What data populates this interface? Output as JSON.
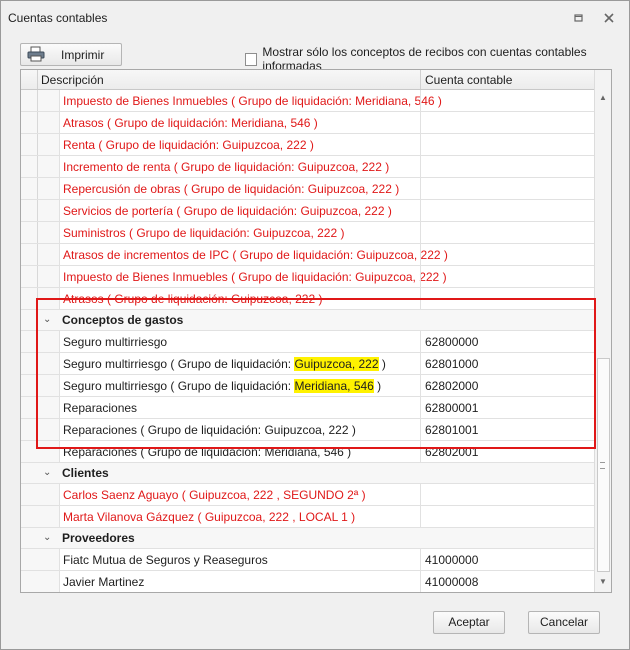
{
  "window": {
    "title": "Cuentas contables"
  },
  "toolbar": {
    "print_label": "Imprimir",
    "checkbox_label": "Mostrar sólo los conceptos de recibos con cuentas contables informadas",
    "checkbox_checked": false
  },
  "grid": {
    "columns": [
      "Descripción",
      "Cuenta contable"
    ],
    "rows_top": [
      {
        "desc": "Impuesto de Bienes Inmuebles ( Grupo de liquidación: Meridiana, 546 )",
        "acct": ""
      },
      {
        "desc": "Atrasos ( Grupo de liquidación: Meridiana, 546 )",
        "acct": ""
      },
      {
        "desc": "Renta ( Grupo de liquidación: Guipuzcoa, 222 )",
        "acct": ""
      },
      {
        "desc": "Incremento de renta ( Grupo de liquidación: Guipuzcoa, 222 )",
        "acct": ""
      },
      {
        "desc": "Repercusión de obras ( Grupo de liquidación: Guipuzcoa, 222 )",
        "acct": ""
      },
      {
        "desc": "Servicios de portería ( Grupo de liquidación: Guipuzcoa, 222 )",
        "acct": ""
      },
      {
        "desc": "Suministros ( Grupo de liquidación: Guipuzcoa, 222 )",
        "acct": ""
      },
      {
        "desc": "Atrasos de incrementos de IPC ( Grupo de liquidación: Guipuzcoa, 222 )",
        "acct": ""
      },
      {
        "desc": "Impuesto de Bienes Inmuebles ( Grupo de liquidación: Guipuzcoa, 222 )",
        "acct": ""
      },
      {
        "desc": "Atrasos ( Grupo de liquidación: Guipuzcoa, 222 )",
        "acct": ""
      }
    ],
    "group_gastos": {
      "label": "Conceptos de gastos",
      "r1": {
        "desc": "Seguro multirriesgo",
        "acct": "62800000"
      },
      "r2": {
        "pre": "Seguro multirriesgo ( Grupo de liquidación: ",
        "hl": "Guipuzcoa, 222",
        "post": " )",
        "acct": "62801000"
      },
      "r3": {
        "pre": "Seguro multirriesgo ( Grupo de liquidación: ",
        "hl": "Meridiana, 546",
        "post": " )",
        "acct": "62802000"
      },
      "r4": {
        "desc": "Reparaciones",
        "acct": "62800001"
      },
      "r5": {
        "desc": "Reparaciones ( Grupo de liquidación: Guipuzcoa, 222 )",
        "acct": "62801001"
      },
      "r6": {
        "desc": "Reparaciones ( Grupo de liquidación: Meridiana, 546 )",
        "acct": "62802001"
      }
    },
    "group_clientes": {
      "label": "Clientes",
      "r1": {
        "desc": "Carlos Saenz Aguayo ( Guipuzcoa, 222 , SEGUNDO 2ª )",
        "acct": ""
      },
      "r2": {
        "desc": "Marta Vilanova Gázquez ( Guipuzcoa, 222 , LOCAL 1 )",
        "acct": ""
      }
    },
    "group_proveedores": {
      "label": "Proveedores",
      "r1": {
        "desc": "Fiatc Mutua de Seguros y Reaseguros",
        "acct": "41000000"
      },
      "r2": {
        "desc": "Javier Martinez",
        "acct": "41000008"
      }
    }
  },
  "footer": {
    "accept_label": "Aceptar",
    "cancel_label": "Cancelar"
  },
  "colors": {
    "error_text": "#e01818",
    "highlight": "#fff200"
  },
  "icons": {
    "restore": "restore-icon",
    "close": "close-icon",
    "printer": "printer-icon",
    "collapse": "chevron-down-icon"
  }
}
